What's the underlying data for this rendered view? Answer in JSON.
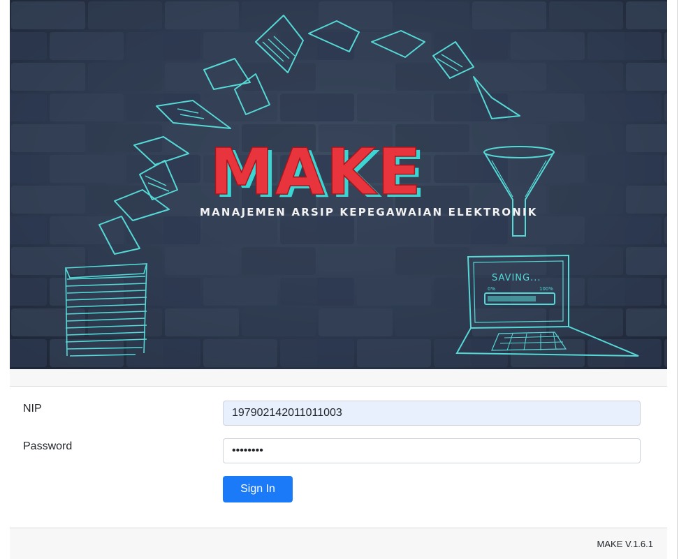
{
  "banner": {
    "logo_text": "MAKE",
    "subtitle": "MANAJEMEN ARSIP KEPEGAWAIAN ELEKTRONIK",
    "laptop_status": "SAVING...",
    "progress_start": "0%",
    "progress_end": "100%",
    "progress_fraction": 0.75,
    "colors": {
      "logo_red": "#e8343d",
      "logo_cyan": "#3ad6d4",
      "sketch_cyan": "#55d9d6",
      "wall_dark": "#2b3547"
    }
  },
  "form": {
    "nip_label": "NIP",
    "nip_value": "197902142011011003",
    "password_label": "Password",
    "password_value": "••••••••",
    "signin_label": "Sign In"
  },
  "footer": {
    "version": "MAKE V.1.6.1"
  },
  "colors": {
    "primary": "#1a7af8",
    "autofill_bg": "#e8f0fe"
  }
}
